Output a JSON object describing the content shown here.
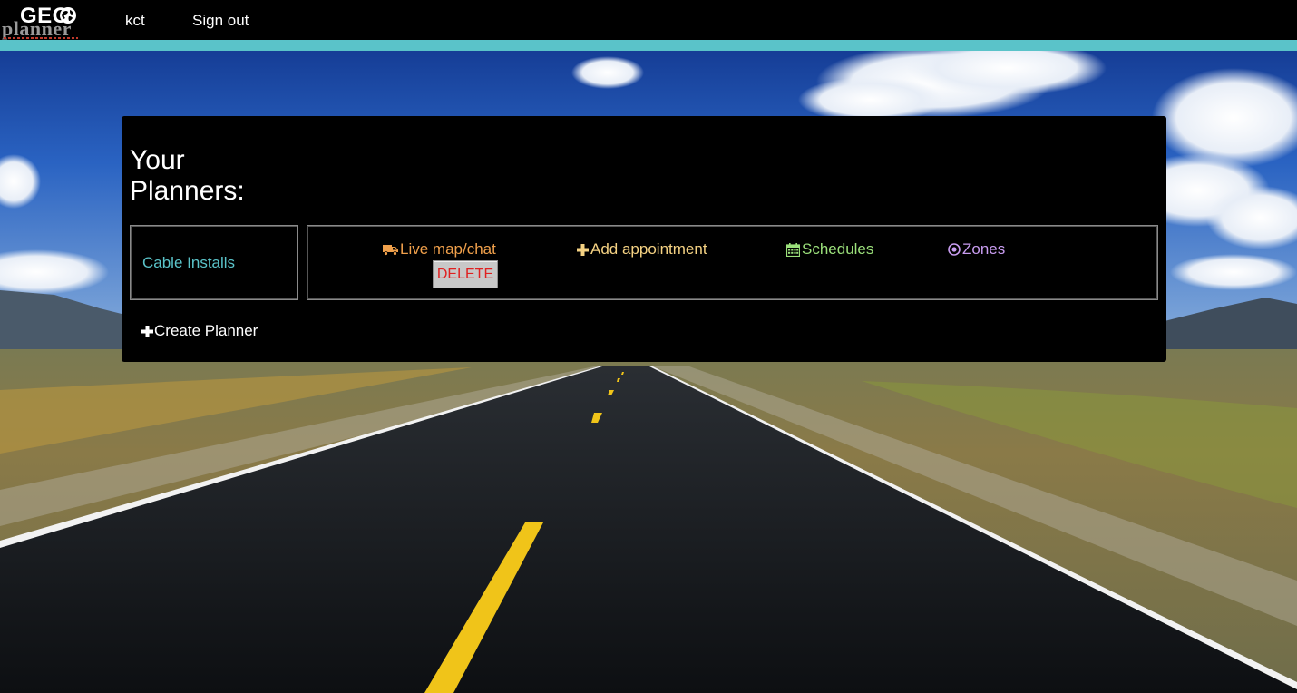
{
  "nav": {
    "logo_top": "GEO",
    "logo_bottom": "planner",
    "user": "kct",
    "signout": "Sign out"
  },
  "main": {
    "title_line1": "Your",
    "title_line2": "Planners:",
    "planners": [
      {
        "name": "Cable Installs",
        "actions": {
          "map": "Live map/chat",
          "add": "Add appointment",
          "schedules": "Schedules",
          "zones": "Zones"
        },
        "delete_label": "DELETE"
      }
    ],
    "create_label": "Create Planner"
  },
  "colors": {
    "accent": "#5ac3c9",
    "map": "#f0a04b",
    "add": "#f5d283",
    "schedules": "#9be07b",
    "zones": "#c89cf0",
    "delete": "#e02020"
  },
  "icons": {
    "map": "truck-icon",
    "add": "plus-icon",
    "schedules": "calendar-icon",
    "zones": "target-icon",
    "create": "plus-icon",
    "logo": "globe-icon"
  }
}
